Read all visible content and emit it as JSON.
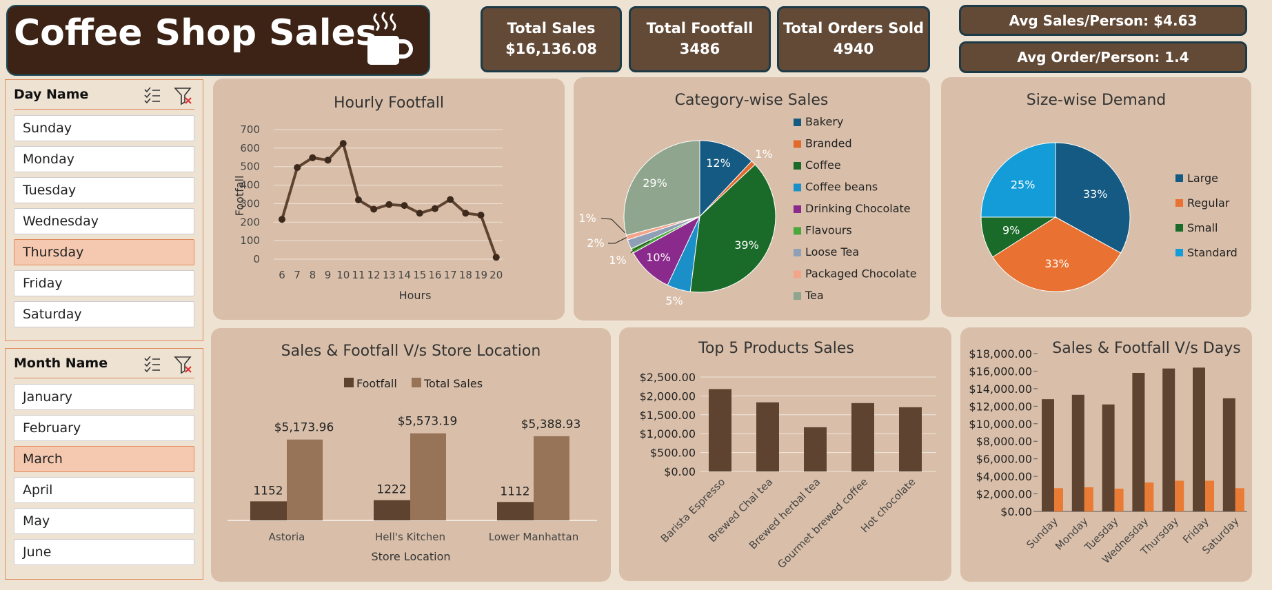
{
  "header": {
    "title": "Coffee Shop Sales",
    "cup_icon": "coffee-cup-icon"
  },
  "kpis": {
    "total_sales_label": "Total Sales",
    "total_sales_value": "$16,136.08",
    "footfall_label": "Total Footfall",
    "footfall_value": "3486",
    "orders_label": "Total Orders Sold",
    "orders_value": "4940",
    "avg_sales": "Avg Sales/Person: $4.63",
    "avg_order": "Avg Order/Person: 1.4"
  },
  "slicers": {
    "day": {
      "title": "Day Name",
      "items": [
        "Sunday",
        "Monday",
        "Tuesday",
        "Wednesday",
        "Thursday",
        "Friday",
        "Saturday"
      ],
      "selected": "Thursday"
    },
    "month": {
      "title": "Month Name",
      "items": [
        "January",
        "February",
        "March",
        "April",
        "May",
        "June"
      ],
      "selected": "March"
    }
  },
  "colors": {
    "dark_brown": "#5e4330",
    "light_brown": "#977358",
    "orange": "#e97b34",
    "panel": "#d9bfa9",
    "background": "#eee2d3"
  },
  "chart_data": [
    {
      "id": "hourly",
      "type": "line",
      "title": "Hourly Footfall",
      "xlabel": "Hours",
      "ylabel": "Footfall",
      "x": [
        6,
        7,
        8,
        9,
        10,
        11,
        12,
        13,
        14,
        15,
        16,
        17,
        18,
        19,
        20
      ],
      "values": [
        215,
        495,
        548,
        535,
        625,
        320,
        270,
        295,
        290,
        248,
        273,
        322,
        248,
        238,
        10
      ],
      "ylim": [
        0,
        700
      ],
      "yticks": [
        0,
        100,
        200,
        300,
        400,
        500,
        600,
        700
      ],
      "grid": true
    },
    {
      "id": "category",
      "type": "pie",
      "title": "Category-wise Sales",
      "labels": [
        "Bakery",
        "Branded",
        "Coffee",
        "Coffee beans",
        "Drinking Chocolate",
        "Flavours",
        "Loose Tea",
        "Packaged Chocolate",
        "Tea"
      ],
      "values": [
        12,
        1,
        39,
        5,
        10,
        1,
        2,
        1,
        29
      ],
      "slice_labels": [
        "12%",
        "1%",
        "39%",
        "5%",
        "10%",
        "1%",
        "2%",
        "1%",
        "29%"
      ],
      "colors": [
        "#155a82",
        "#e06b2c",
        "#1a6b2a",
        "#1b8fc8",
        "#8a2a8c",
        "#4aa83a",
        "#8f9fb5",
        "#f2a58a",
        "#8fa58d"
      ],
      "legend": "right"
    },
    {
      "id": "size",
      "type": "pie",
      "title": "Size-wise Demand",
      "labels": [
        "Large",
        "Regular",
        "Small",
        "Standard"
      ],
      "values": [
        33,
        33,
        9,
        25
      ],
      "slice_labels": [
        "33%",
        "33%",
        "9%",
        "25%"
      ],
      "colors": [
        "#155a82",
        "#e97131",
        "#1a6b2a",
        "#139cd8"
      ],
      "legend": "right"
    },
    {
      "id": "location",
      "type": "bar",
      "title": "Sales & Footfall V/s Store Location",
      "xlabel": "Store Location",
      "categories": [
        "Astoria",
        "Hell's Kitchen",
        "Lower Manhattan"
      ],
      "series": [
        {
          "name": "Footfall",
          "values": [
            1152,
            1222,
            1112
          ],
          "labels": [
            "1152",
            "1222",
            "1112"
          ]
        },
        {
          "name": "Total Sales",
          "values": [
            5173.96,
            5573.19,
            5388.93
          ],
          "labels": [
            "$5,173.96",
            "$5,573.19",
            "$5,388.93"
          ]
        }
      ],
      "legend": "top"
    },
    {
      "id": "top5",
      "type": "bar",
      "title": "Top 5 Products Sales",
      "categories": [
        "Barista Espresso",
        "Brewed Chai tea",
        "Brewed herbal tea",
        "Gourmet brewed coffee",
        "Hot chocolate"
      ],
      "values": [
        2180,
        1830,
        1170,
        1810,
        1700
      ],
      "ylim": [
        0,
        2500
      ],
      "yticks": [
        "$0.00",
        "$500.00",
        "$1,000.00",
        "$1,500.00",
        "$2,000.00",
        "$2,500.00"
      ]
    },
    {
      "id": "days",
      "type": "bar",
      "title": "Sales & Footfall V/s Days",
      "categories": [
        "Sunday",
        "Monday",
        "Tuesday",
        "Wednesday",
        "Thursday",
        "Friday",
        "Saturday"
      ],
      "series": [
        {
          "values": [
            12800,
            13300,
            12200,
            15800,
            16300,
            16400,
            12900
          ]
        },
        {
          "values": [
            2650,
            2750,
            2600,
            3300,
            3500,
            3500,
            2650
          ]
        }
      ],
      "ylim": [
        0,
        18000
      ],
      "yticks": [
        "$0.00",
        "$2,000.00",
        "$4,000.00",
        "$6,000.00",
        "$8,000.00",
        "$10,000.00",
        "$12,000.00",
        "$14,000.00",
        "$16,000.00",
        "$18,000.00"
      ]
    }
  ]
}
